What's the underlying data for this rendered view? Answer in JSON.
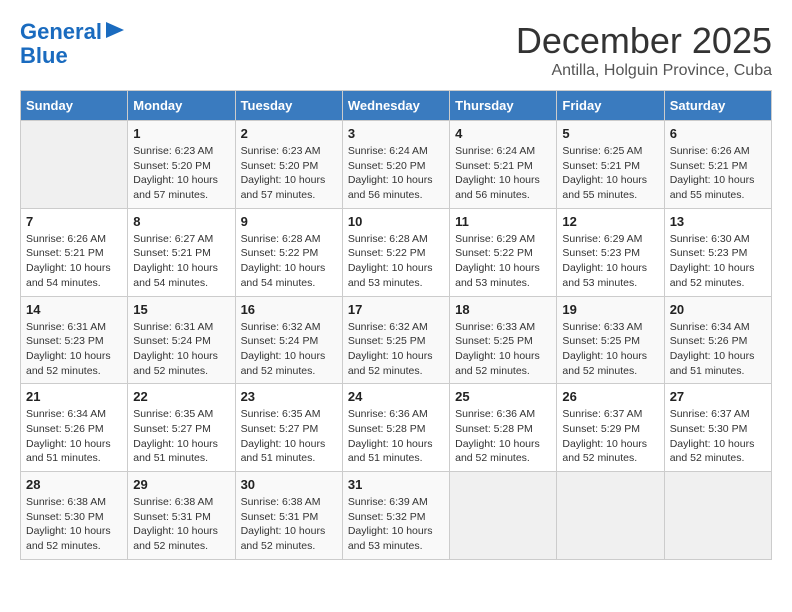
{
  "header": {
    "logo_line1": "General",
    "logo_line2": "Blue",
    "month": "December 2025",
    "location": "Antilla, Holguin Province, Cuba"
  },
  "columns": [
    "Sunday",
    "Monday",
    "Tuesday",
    "Wednesday",
    "Thursday",
    "Friday",
    "Saturday"
  ],
  "weeks": [
    [
      {
        "day": "",
        "info": ""
      },
      {
        "day": "1",
        "info": "Sunrise: 6:23 AM\nSunset: 5:20 PM\nDaylight: 10 hours and 57 minutes."
      },
      {
        "day": "2",
        "info": "Sunrise: 6:23 AM\nSunset: 5:20 PM\nDaylight: 10 hours and 57 minutes."
      },
      {
        "day": "3",
        "info": "Sunrise: 6:24 AM\nSunset: 5:20 PM\nDaylight: 10 hours and 56 minutes."
      },
      {
        "day": "4",
        "info": "Sunrise: 6:24 AM\nSunset: 5:21 PM\nDaylight: 10 hours and 56 minutes."
      },
      {
        "day": "5",
        "info": "Sunrise: 6:25 AM\nSunset: 5:21 PM\nDaylight: 10 hours and 55 minutes."
      },
      {
        "day": "6",
        "info": "Sunrise: 6:26 AM\nSunset: 5:21 PM\nDaylight: 10 hours and 55 minutes."
      }
    ],
    [
      {
        "day": "7",
        "info": "Sunrise: 6:26 AM\nSunset: 5:21 PM\nDaylight: 10 hours and 54 minutes."
      },
      {
        "day": "8",
        "info": "Sunrise: 6:27 AM\nSunset: 5:21 PM\nDaylight: 10 hours and 54 minutes."
      },
      {
        "day": "9",
        "info": "Sunrise: 6:28 AM\nSunset: 5:22 PM\nDaylight: 10 hours and 54 minutes."
      },
      {
        "day": "10",
        "info": "Sunrise: 6:28 AM\nSunset: 5:22 PM\nDaylight: 10 hours and 53 minutes."
      },
      {
        "day": "11",
        "info": "Sunrise: 6:29 AM\nSunset: 5:22 PM\nDaylight: 10 hours and 53 minutes."
      },
      {
        "day": "12",
        "info": "Sunrise: 6:29 AM\nSunset: 5:23 PM\nDaylight: 10 hours and 53 minutes."
      },
      {
        "day": "13",
        "info": "Sunrise: 6:30 AM\nSunset: 5:23 PM\nDaylight: 10 hours and 52 minutes."
      }
    ],
    [
      {
        "day": "14",
        "info": "Sunrise: 6:31 AM\nSunset: 5:23 PM\nDaylight: 10 hours and 52 minutes."
      },
      {
        "day": "15",
        "info": "Sunrise: 6:31 AM\nSunset: 5:24 PM\nDaylight: 10 hours and 52 minutes."
      },
      {
        "day": "16",
        "info": "Sunrise: 6:32 AM\nSunset: 5:24 PM\nDaylight: 10 hours and 52 minutes."
      },
      {
        "day": "17",
        "info": "Sunrise: 6:32 AM\nSunset: 5:25 PM\nDaylight: 10 hours and 52 minutes."
      },
      {
        "day": "18",
        "info": "Sunrise: 6:33 AM\nSunset: 5:25 PM\nDaylight: 10 hours and 52 minutes."
      },
      {
        "day": "19",
        "info": "Sunrise: 6:33 AM\nSunset: 5:25 PM\nDaylight: 10 hours and 52 minutes."
      },
      {
        "day": "20",
        "info": "Sunrise: 6:34 AM\nSunset: 5:26 PM\nDaylight: 10 hours and 51 minutes."
      }
    ],
    [
      {
        "day": "21",
        "info": "Sunrise: 6:34 AM\nSunset: 5:26 PM\nDaylight: 10 hours and 51 minutes."
      },
      {
        "day": "22",
        "info": "Sunrise: 6:35 AM\nSunset: 5:27 PM\nDaylight: 10 hours and 51 minutes."
      },
      {
        "day": "23",
        "info": "Sunrise: 6:35 AM\nSunset: 5:27 PM\nDaylight: 10 hours and 51 minutes."
      },
      {
        "day": "24",
        "info": "Sunrise: 6:36 AM\nSunset: 5:28 PM\nDaylight: 10 hours and 51 minutes."
      },
      {
        "day": "25",
        "info": "Sunrise: 6:36 AM\nSunset: 5:28 PM\nDaylight: 10 hours and 52 minutes."
      },
      {
        "day": "26",
        "info": "Sunrise: 6:37 AM\nSunset: 5:29 PM\nDaylight: 10 hours and 52 minutes."
      },
      {
        "day": "27",
        "info": "Sunrise: 6:37 AM\nSunset: 5:30 PM\nDaylight: 10 hours and 52 minutes."
      }
    ],
    [
      {
        "day": "28",
        "info": "Sunrise: 6:38 AM\nSunset: 5:30 PM\nDaylight: 10 hours and 52 minutes."
      },
      {
        "day": "29",
        "info": "Sunrise: 6:38 AM\nSunset: 5:31 PM\nDaylight: 10 hours and 52 minutes."
      },
      {
        "day": "30",
        "info": "Sunrise: 6:38 AM\nSunset: 5:31 PM\nDaylight: 10 hours and 52 minutes."
      },
      {
        "day": "31",
        "info": "Sunrise: 6:39 AM\nSunset: 5:32 PM\nDaylight: 10 hours and 53 minutes."
      },
      {
        "day": "",
        "info": ""
      },
      {
        "day": "",
        "info": ""
      },
      {
        "day": "",
        "info": ""
      }
    ]
  ]
}
